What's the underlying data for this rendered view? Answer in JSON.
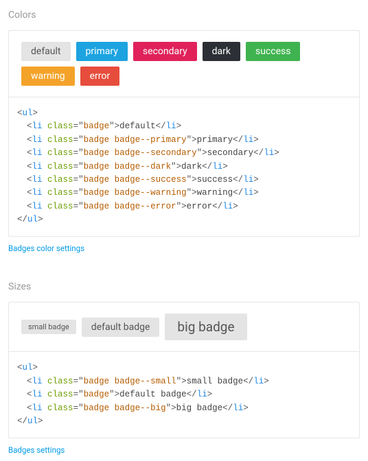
{
  "colors": {
    "title": "Colors",
    "link": "Badges color settings",
    "badges": [
      {
        "label": "default",
        "cls": "badge"
      },
      {
        "label": "primary",
        "cls": "badge badge--primary"
      },
      {
        "label": "secondary",
        "cls": "badge badge--secondary"
      },
      {
        "label": "dark",
        "cls": "badge badge--dark"
      },
      {
        "label": "success",
        "cls": "badge badge--success"
      },
      {
        "label": "warning",
        "cls": "badge badge--warning"
      },
      {
        "label": "error",
        "cls": "badge badge--error"
      }
    ],
    "code": [
      {
        "class": "badge",
        "text": "default"
      },
      {
        "class": "badge badge--primary",
        "text": "primary"
      },
      {
        "class": "badge badge--secondary",
        "text": "secondary"
      },
      {
        "class": "badge badge--dark",
        "text": "dark"
      },
      {
        "class": "badge badge--success",
        "text": "success"
      },
      {
        "class": "badge badge--warning",
        "text": "warning"
      },
      {
        "class": "badge badge--error",
        "text": "error"
      }
    ]
  },
  "sizes": {
    "title": "Sizes",
    "link": "Badges settings",
    "badges": [
      {
        "label": "small badge",
        "cls": "badge badge--small"
      },
      {
        "label": "default badge",
        "cls": "badge"
      },
      {
        "label": "big badge",
        "cls": "badge badge--big"
      }
    ],
    "code": [
      {
        "class": "badge badge--small",
        "text": "small badge"
      },
      {
        "class": "badge",
        "text": "default badge"
      },
      {
        "class": "badge badge--big",
        "text": "big badge"
      }
    ]
  }
}
